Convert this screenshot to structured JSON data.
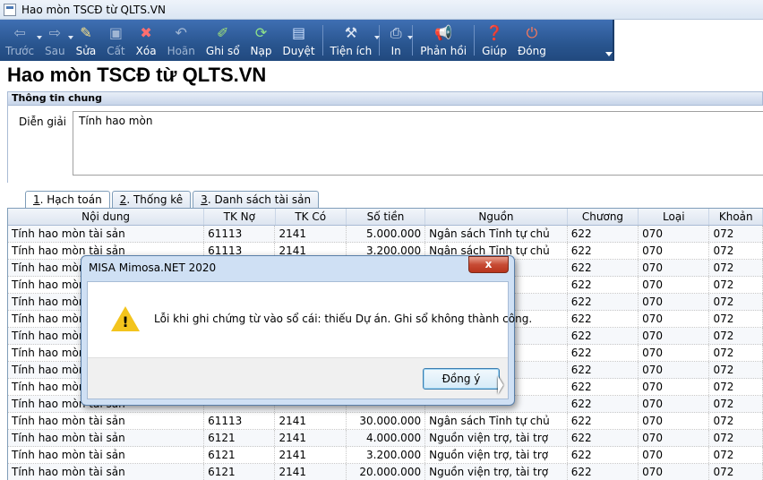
{
  "window": {
    "title": "Hao mòn TSCĐ từ QLTS.VN"
  },
  "toolbar": {
    "buttons": [
      {
        "label": "Trước",
        "icon": "arrow-left-icon",
        "disabled": true
      },
      {
        "label": "Sau",
        "icon": "arrow-right-icon",
        "disabled": true
      },
      {
        "label": "Sửa",
        "icon": "edit-icon",
        "disabled": false
      },
      {
        "label": "Cất",
        "icon": "save-icon",
        "disabled": true
      },
      {
        "label": "Xóa",
        "icon": "delete-icon",
        "disabled": false
      },
      {
        "label": "Hoãn",
        "icon": "undo-icon",
        "disabled": true
      },
      {
        "label": "Ghi sổ",
        "icon": "pencil-icon",
        "disabled": false
      },
      {
        "label": "Nạp",
        "icon": "refresh-icon",
        "disabled": false
      },
      {
        "label": "Duyệt",
        "icon": "document-icon",
        "disabled": false
      },
      {
        "label": "Tiện ích",
        "icon": "tools-icon",
        "disabled": false
      },
      {
        "label": "In",
        "icon": "printer-icon",
        "disabled": false
      },
      {
        "label": "Phản hồi",
        "icon": "megaphone-icon",
        "disabled": false
      },
      {
        "label": "Giúp",
        "icon": "help-icon",
        "disabled": false
      },
      {
        "label": "Đóng",
        "icon": "power-icon",
        "disabled": false
      }
    ]
  },
  "page": {
    "title": "Hao mòn TSCĐ từ QLTS.VN"
  },
  "general": {
    "section_title": "Thông tin chung",
    "desc_label": "Diễn giải",
    "desc_value": "Tính hao mòn"
  },
  "tabs": [
    {
      "key": "1",
      "label": ". Hạch toán"
    },
    {
      "key": "2",
      "label": ". Thống kê"
    },
    {
      "key": "3",
      "label": ". Danh sách tài sản"
    }
  ],
  "grid": {
    "columns": [
      "Nội dung",
      "TK Nợ",
      "TK Có",
      "Số tiền",
      "Nguồn",
      "Chương",
      "Loại",
      "Khoản"
    ],
    "rows": [
      [
        "Tính hao mòn tài sản",
        "61113",
        "2141",
        "5.000.000",
        "Ngân sách Tỉnh tự chủ",
        "622",
        "070",
        "072"
      ],
      [
        "Tính hao mòn tài sản",
        "61113",
        "2141",
        "3.200.000",
        "Ngân sách Tỉnh tự chủ",
        "622",
        "070",
        "072"
      ],
      [
        "Tính hao mòn tài sản",
        "",
        "",
        "",
        "",
        "622",
        "070",
        "072"
      ],
      [
        "Tính hao mòn tài sản",
        "",
        "",
        "",
        "",
        "622",
        "070",
        "072"
      ],
      [
        "Tính hao mòn tài sản",
        "",
        "",
        "",
        "",
        "622",
        "070",
        "072"
      ],
      [
        "Tính hao mòn tài sản",
        "",
        "",
        "",
        "",
        "622",
        "070",
        "072"
      ],
      [
        "Tính hao mòn tài sản",
        "",
        "",
        "",
        "",
        "622",
        "070",
        "072"
      ],
      [
        "Tính hao mòn tài sản",
        "",
        "",
        "",
        "",
        "622",
        "070",
        "072"
      ],
      [
        "Tính hao mòn tài sản",
        "",
        "",
        "",
        "",
        "622",
        "070",
        "072"
      ],
      [
        "Tính hao mòn tài sản",
        "",
        "",
        "",
        "",
        "622",
        "070",
        "072"
      ],
      [
        "Tính hao mòn tài sản",
        "",
        "",
        "",
        "",
        "622",
        "070",
        "072"
      ],
      [
        "Tính hao mòn tài sản",
        "61113",
        "2141",
        "30.000.000",
        "Ngân sách Tỉnh tự chủ",
        "622",
        "070",
        "072"
      ],
      [
        "Tính hao mòn tài sản",
        "6121",
        "2141",
        "4.000.000",
        "Nguồn viện trợ, tài trợ",
        "622",
        "070",
        "072"
      ],
      [
        "Tính hao mòn tài sản",
        "6121",
        "2141",
        "3.200.000",
        "Nguồn viện trợ, tài trợ",
        "622",
        "070",
        "072"
      ],
      [
        "Tính hao mòn tài sản",
        "6121",
        "2141",
        "20.000.000",
        "Nguồn viện trợ, tài trợ",
        "622",
        "070",
        "072"
      ]
    ]
  },
  "dialog": {
    "title": "MISA Mimosa.NET 2020",
    "close_label": "x",
    "message": "Lỗi khi ghi chứng từ vào sổ cái: thiếu Dự án. Ghi sổ không thành công.",
    "ok_label": "Đồng ý"
  }
}
